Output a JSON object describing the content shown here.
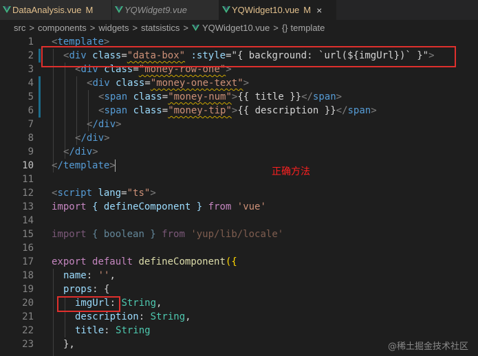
{
  "tabs": [
    {
      "label": "DataAnalysis.vue",
      "modified_marker": "M",
      "active": false
    },
    {
      "label": "YQWidget9.vue",
      "active": false
    },
    {
      "label": "YQWidget10.vue",
      "modified_marker": "M",
      "close": "×",
      "active": true
    }
  ],
  "breadcrumb": {
    "items": [
      "src",
      "components",
      "widgets",
      "statsistics",
      "YQWidget10.vue",
      "template"
    ],
    "separator": ">",
    "brace_icon": "{}"
  },
  "line_numbers": [
    "1",
    "2",
    "3",
    "4",
    "5",
    "6",
    "7",
    "8",
    "9",
    "10",
    "11",
    "12",
    "13",
    "14",
    "15",
    "16",
    "17",
    "18",
    "19",
    "20",
    "21",
    "22",
    "23"
  ],
  "code": {
    "l1": {
      "tag": "template"
    },
    "l2": {
      "tag": "div",
      "attr1": "class",
      "val1": "\"data-box\"",
      "attr2": ":style",
      "val2": "\"{ background: `url(${imgUrl})` }\""
    },
    "l3": {
      "tag": "div",
      "attr": "class",
      "val": "\"money-row-one\""
    },
    "l4": {
      "tag": "div",
      "attr": "class",
      "val": "\"money-one-text\""
    },
    "l5": {
      "tag": "span",
      "attr": "class",
      "val": "\"money-num\"",
      "text": "{{ title }}"
    },
    "l6": {
      "tag": "span",
      "attr": "class",
      "val": "\"money-tip\"",
      "text": "{{ description }}"
    },
    "l7": {
      "tag": "/div"
    },
    "l8": {
      "tag": "/div"
    },
    "l9": {
      "tag": "/div"
    },
    "l10": {
      "tag": "/template"
    },
    "l12": {
      "tag": "script",
      "attr": "lang",
      "val": "\"ts\""
    },
    "l13": {
      "kw": "import",
      "body": "{ defineComponent }",
      "from": "from",
      "mod": "'vue'"
    },
    "l15": {
      "kw": "import",
      "body": "{ boolean }",
      "from": "from",
      "mod": "'yup/lib/locale'"
    },
    "l17": {
      "kw1": "export",
      "kw2": "default",
      "fn": "defineComponent",
      "rest": "({"
    },
    "l18": {
      "key": "name",
      "val": "''"
    },
    "l19": {
      "key": "props",
      "rest": ": {"
    },
    "l20": {
      "key": "imgUrl",
      "type": "String"
    },
    "l21": {
      "key": "description",
      "type": "String"
    },
    "l22": {
      "key": "title",
      "type": "String"
    },
    "l23": {
      "text": "},"
    }
  },
  "annotation": "正确方法",
  "watermark": "@稀土掘金技术社区",
  "colors": {
    "annotation_box": "#e0302d",
    "editor_bg": "#1e1e1e"
  }
}
